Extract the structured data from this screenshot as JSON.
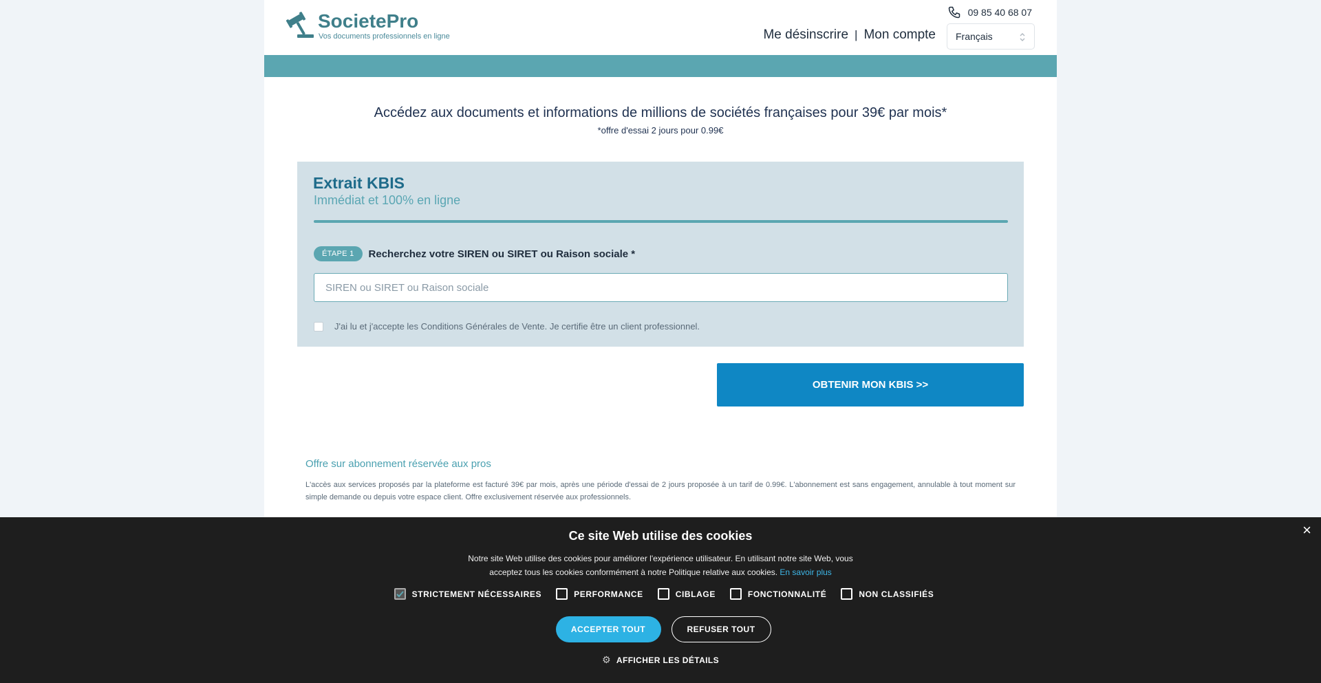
{
  "header": {
    "logo_name": "SocietePro",
    "logo_tagline": "Vos documents professionnels en ligne",
    "phone": "09 85 40 68 07",
    "nav": {
      "unsubscribe": "Me désinscrire",
      "separator": "|",
      "account": "Mon compte"
    },
    "language": "Français"
  },
  "intro": {
    "headline": "Accédez aux documents et informations de millions de sociétés françaises pour 39€ par mois*",
    "footnote": "*offre d'essai 2 jours pour 0.99€"
  },
  "kbis": {
    "title": "Extrait KBIS",
    "subtitle": "Immédiat et 100% en ligne",
    "step_badge": "ÉTAPE 1",
    "step_label": "Recherchez votre SIREN ou SIRET ou Raison sociale *",
    "search_placeholder": "SIREN ou SIRET ou Raison sociale",
    "terms_label": "J'ai lu et j'accepte les Conditions Générales de Vente. Je certifie être un client professionnel.",
    "terms_checked": false
  },
  "cta": {
    "label": "OBTENIR MON KBIS >>"
  },
  "offer": {
    "title": "Offre sur abonnement réservée aux pros",
    "text": "L'accès aux services proposés par la plateforme est facturé 39€ par mois, après une période d'essai de 2 jours proposée à un tarif de 0.99€. L'abonnement est sans engagement, annulable à tout moment sur simple demande ou depuis votre espace client. Offre exclusivement réservée aux professionnels."
  },
  "cookie": {
    "close": "×",
    "title": "Ce site Web utilise des cookies",
    "text": "Notre site Web utilise des cookies pour améliorer l'expérience utilisateur. En utilisant notre site Web, vous acceptez tous les cookies conformément à notre Politique relative aux cookies.",
    "learn_more": "En savoir plus",
    "options": [
      {
        "label": "STRICTEMENT NÉCESSAIRES",
        "checked": true
      },
      {
        "label": "PERFORMANCE",
        "checked": false
      },
      {
        "label": "CIBLAGE",
        "checked": false
      },
      {
        "label": "FONCTIONNALITÉ",
        "checked": false
      },
      {
        "label": "NON CLASSIFIÉS",
        "checked": false
      }
    ],
    "accept_all": "ACCEPTER TOUT",
    "refuse_all": "REFUSER TOUT",
    "show_details": "AFFICHER LES DÉTAILS"
  },
  "colors": {
    "brand_teal": "#5ba6b1",
    "cta_blue": "#0f87c4",
    "cookie_bg": "#1e1e1e",
    "accept_blue": "#2db2e4"
  }
}
